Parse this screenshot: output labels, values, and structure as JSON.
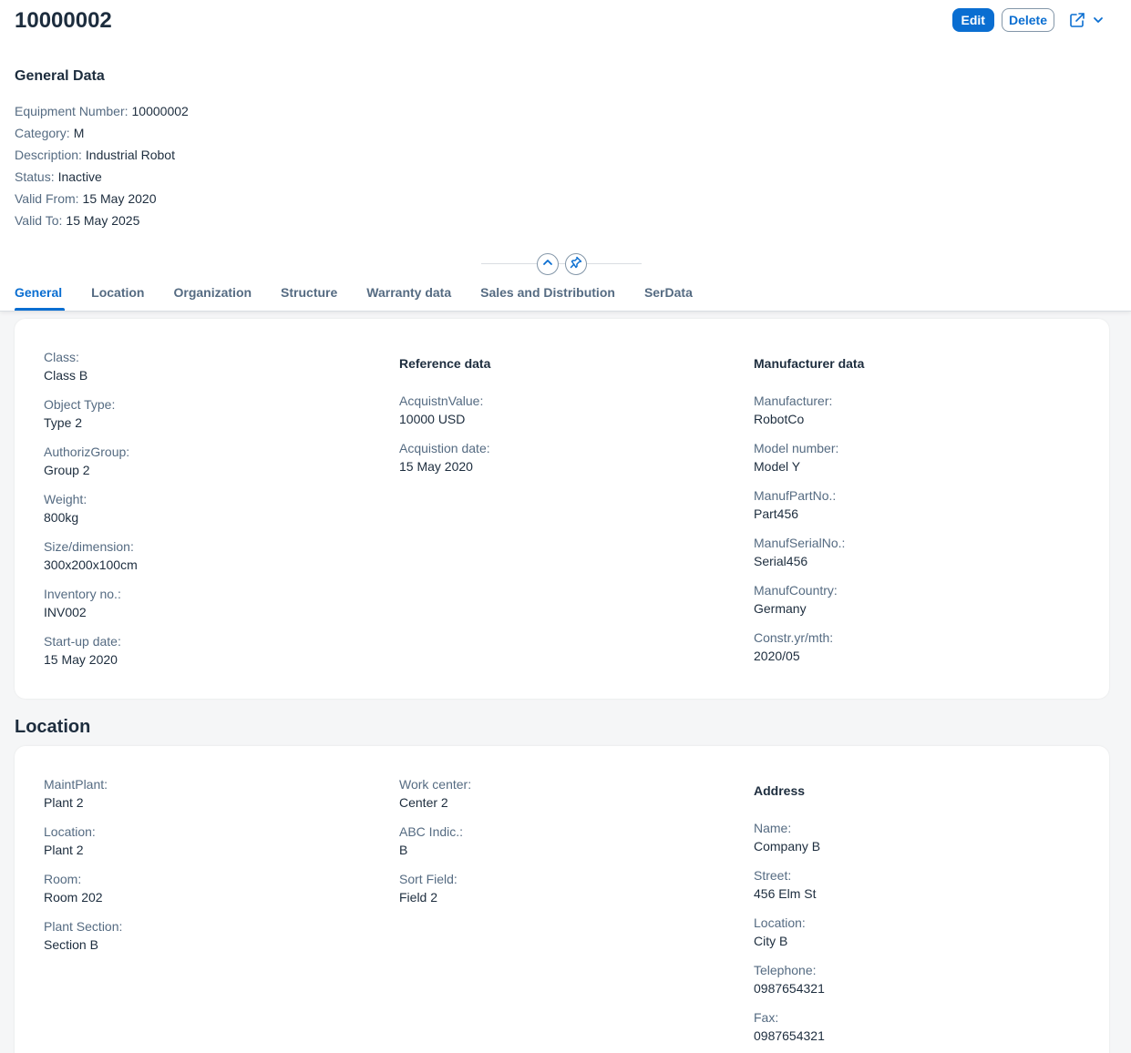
{
  "object_title": "10000002",
  "actions": {
    "edit": "Edit",
    "delete": "Delete",
    "share_icon": "share-icon",
    "dropdown_icon": "chevron-down-icon"
  },
  "general_data": {
    "title": "General Data",
    "rows": [
      {
        "label": "Equipment Number:",
        "value": "10000002"
      },
      {
        "label": "Category:",
        "value": "M"
      },
      {
        "label": "Description:",
        "value": "Industrial Robot"
      },
      {
        "label": "Status:",
        "value": "Inactive"
      },
      {
        "label": "Valid From:",
        "value": "15 May 2020"
      },
      {
        "label": "Valid To:",
        "value": "15 May 2025"
      }
    ]
  },
  "header_controls": {
    "collapse_icon": "chevron-up-icon",
    "pin_icon": "pin-icon"
  },
  "tabs": [
    {
      "label": "General",
      "active": true
    },
    {
      "label": "Location"
    },
    {
      "label": "Organization"
    },
    {
      "label": "Structure"
    },
    {
      "label": "Warranty data"
    },
    {
      "label": "Sales and Distribution"
    },
    {
      "label": "SerData"
    }
  ],
  "general_section": {
    "col1": [
      {
        "label": "Class:",
        "value": "Class B"
      },
      {
        "label": "Object Type:",
        "value": "Type 2"
      },
      {
        "label": "AuthorizGroup:",
        "value": "Group 2"
      },
      {
        "label": "Weight:",
        "value": "800kg"
      },
      {
        "label": "Size/dimension:",
        "value": "300x200x100cm"
      },
      {
        "label": "Inventory no.:",
        "value": "INV002"
      },
      {
        "label": "Start-up date:",
        "value": "15 May 2020"
      }
    ],
    "reference_title": "Reference data",
    "col2": [
      {
        "label": "AcquistnValue:",
        "value": "10000 USD"
      },
      {
        "label": "Acquistion date:",
        "value": "15 May 2020"
      }
    ],
    "manufacturer_title": "Manufacturer data",
    "col3": [
      {
        "label": "Manufacturer:",
        "value": "RobotCo"
      },
      {
        "label": "Model number:",
        "value": "Model Y"
      },
      {
        "label": "ManufPartNo.:",
        "value": "Part456"
      },
      {
        "label": "ManufSerialNo.:",
        "value": "Serial456"
      },
      {
        "label": "ManufCountry:",
        "value": "Germany"
      },
      {
        "label": "Constr.yr/mth:",
        "value": "2020/05"
      }
    ]
  },
  "location_section": {
    "title": "Location",
    "col1": [
      {
        "label": "MaintPlant:",
        "value": "Plant 2"
      },
      {
        "label": "Location:",
        "value": "Plant 2"
      },
      {
        "label": "Room:",
        "value": "Room 202"
      },
      {
        "label": "Plant Section:",
        "value": "Section B"
      }
    ],
    "col2": [
      {
        "label": "Work center:",
        "value": "Center 2"
      },
      {
        "label": "ABC Indic.:",
        "value": "B"
      },
      {
        "label": "Sort Field:",
        "value": "Field 2"
      }
    ],
    "address_title": "Address",
    "col3": [
      {
        "label": "Name:",
        "value": "Company B"
      },
      {
        "label": "Street:",
        "value": "456 Elm St"
      },
      {
        "label": "Location:",
        "value": "City B"
      },
      {
        "label": "Telephone:",
        "value": "0987654321"
      },
      {
        "label": "Fax:",
        "value": "0987654321"
      }
    ]
  }
}
